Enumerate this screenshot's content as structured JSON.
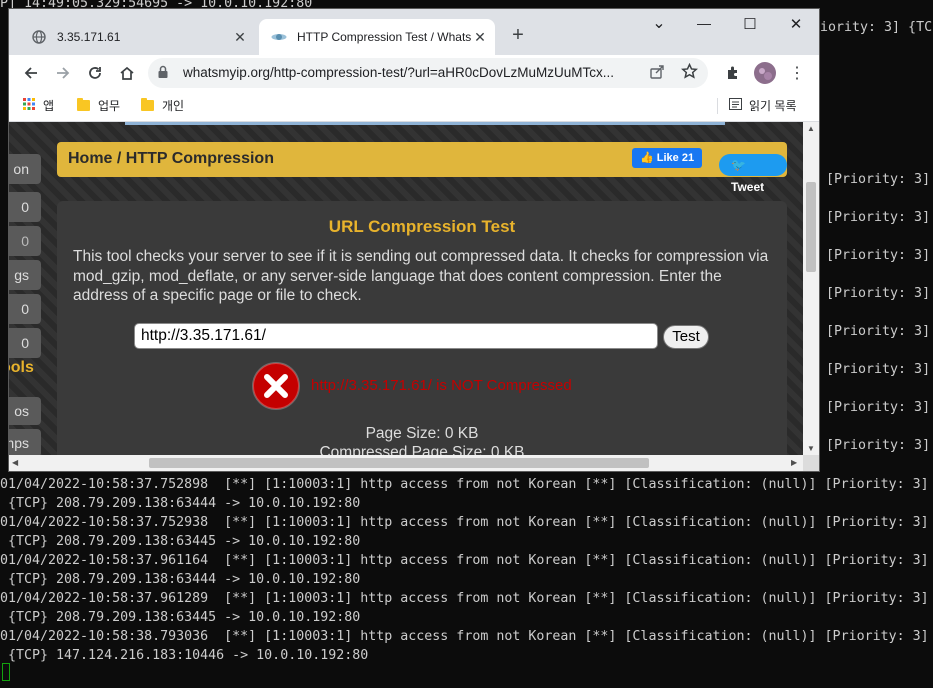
{
  "terminal": {
    "top_partial": "P] 14:49:05.329:54695 -> 10.0.10.192:80",
    "top_right_partial": "iority: 3] {TC",
    "right_priority": "[Priority: 3]",
    "left_prefix": "0",
    "lines": [
      "01/04/2022-10:58:37.752898  [**] [1:10003:1] http access from not Korean [**] [Classification: (null)] [Priority: 3]",
      " {TCP} 208.79.209.138:63444 -> 10.0.10.192:80",
      "01/04/2022-10:58:37.752938  [**] [1:10003:1] http access from not Korean [**] [Classification: (null)] [Priority: 3]",
      " {TCP} 208.79.209.138:63445 -> 10.0.10.192:80",
      "01/04/2022-10:58:37.961164  [**] [1:10003:1] http access from not Korean [**] [Classification: (null)] [Priority: 3]",
      " {TCP} 208.79.209.138:63444 -> 10.0.10.192:80",
      "01/04/2022-10:58:37.961289  [**] [1:10003:1] http access from not Korean [**] [Classification: (null)] [Priority: 3]",
      " {TCP} 208.79.209.138:63445 -> 10.0.10.192:80",
      "01/04/2022-10:58:38.793036  [**] [1:10003:1] http access from not Korean [**] [Classification: (null)] [Priority: 3]",
      " {TCP} 147.124.216.183:10446 -> 10.0.10.192:80"
    ]
  },
  "browser": {
    "tabs": [
      {
        "title": "3.35.171.61",
        "close": "✕"
      },
      {
        "title": "HTTP Compression Test / Whats",
        "close": "✕"
      }
    ],
    "new_tab": "+",
    "window_buttons": {
      "minimize": "—",
      "maximize": "☐",
      "close": "✕",
      "dropdown": "⌄"
    },
    "url": "whatsmyip.org/http-compression-test/?url=aHR0cDovLzMuMzUuMTcx...",
    "bookmarks": {
      "apps": "앱",
      "items": [
        "업무",
        "개인"
      ],
      "reading_list": "읽기 목록"
    }
  },
  "page": {
    "left_nav": [
      "on",
      "0",
      "0",
      "gs",
      "0",
      "0",
      "os",
      "nps"
    ],
    "left_nav_heading": "ools",
    "breadcrumb": "Home / HTTP Compression",
    "facebook_like": "Like 21",
    "tweet": "Tweet",
    "card_title": "URL Compression Test",
    "description": "This tool checks your server to see if it is sending out compressed data. It checks for compression via mod_gzip, mod_deflate, or any server-side language that does content compression. Enter the address of a specific page or file to check.",
    "url_value": "http://3.35.171.61/",
    "test_button": "Test",
    "result_text": "http://3.35.171.61/ is NOT Compressed",
    "page_size": "Page Size: 0 KB",
    "compressed_size": "Compressed Page Size: 0 KB"
  },
  "colors": {
    "terminal_bg": "#0c0c0c",
    "accent_gold": "#e0b63c",
    "error_red": "#c40000"
  }
}
